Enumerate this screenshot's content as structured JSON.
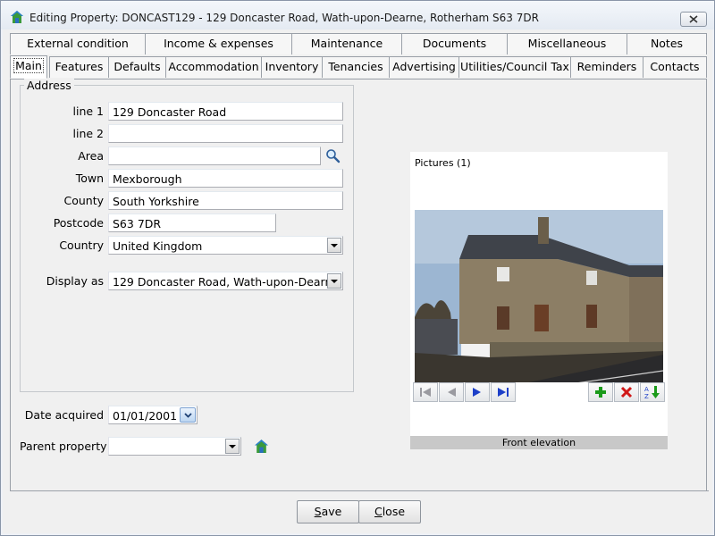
{
  "window": {
    "title": "Editing Property: DONCAST129 - 129 Doncaster Road, Wath-upon-Dearne, Rotherham S63 7DR"
  },
  "tabs_row1": [
    "External condition",
    "Income & expenses",
    "Maintenance",
    "Documents",
    "Miscellaneous",
    "Notes"
  ],
  "tabs_row2": [
    "Main",
    "Features",
    "Defaults",
    "Accommodation",
    "Inventory",
    "Tenancies",
    "Advertising",
    "Utilities/Council Tax",
    "Reminders",
    "Contacts"
  ],
  "active_tab": "Main",
  "address": {
    "legend": "Address",
    "line1_label": "line 1",
    "line1_value": "129 Doncaster Road",
    "line2_label": "line 2",
    "line2_value": "",
    "area_label": "Area",
    "area_value": "",
    "town_label": "Town",
    "town_value": "Mexborough",
    "county_label": "County",
    "county_value": "South Yorkshire",
    "postcode_label": "Postcode",
    "postcode_value": "S63 7DR",
    "country_label": "Country",
    "country_value": "United Kingdom",
    "display_as_label": "Display as",
    "display_as_value": "129 Doncaster Road, Wath-upon-Dearne, R"
  },
  "date_acquired_label": "Date acquired",
  "date_acquired_value": "01/01/2001",
  "parent_property_label": "Parent property",
  "parent_property_value": "",
  "pictures": {
    "title": "Pictures (1)",
    "caption": "Front elevation"
  },
  "buttons": {
    "save_prefix": "S",
    "save_rest": "ave",
    "close_prefix": "C",
    "close_rest": "lose"
  },
  "icons": {
    "house": "house-icon",
    "search": "magnifier-icon",
    "first": "first-record-icon",
    "prev": "previous-record-icon",
    "next": "next-record-icon",
    "last": "last-record-icon",
    "add": "add-icon",
    "delete": "delete-icon",
    "sort": "sort-az-icon"
  },
  "colors": {
    "nav_blue": "#1c3fc8",
    "add_green": "#1a9a1a",
    "delete_red": "#d01818"
  }
}
